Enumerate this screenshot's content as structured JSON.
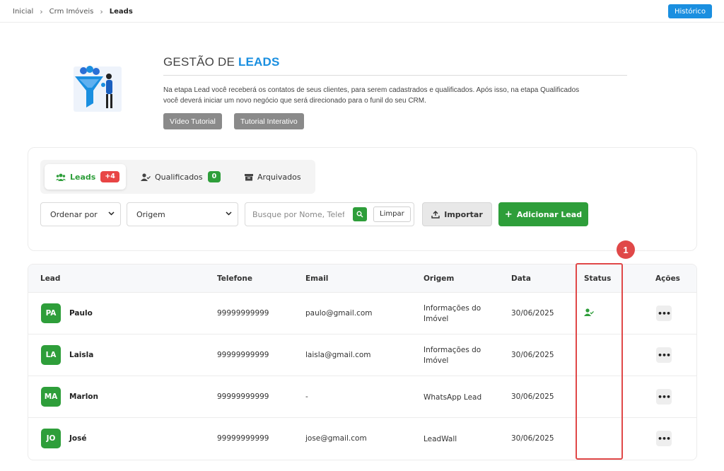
{
  "breadcrumb": [
    "Inicial",
    "Crm Imóveis",
    "Leads"
  ],
  "header": {
    "history_button": "Histórico"
  },
  "hero": {
    "title_prefix": "GESTÃO DE",
    "title_highlight": "LEADS",
    "description_line1": "Na etapa Lead você receberá os contatos de seus clientes, para serem cadastrados e qualificados. Após isso, na etapa Qualificados",
    "description_line2": "você deverá iniciar um novo negócio que será direcionado para o funil do seu CRM.",
    "buttons": [
      "Vídeo Tutorial",
      "Tutorial Interativo"
    ]
  },
  "tabs": [
    {
      "label": "Leads",
      "badge": "+4",
      "badge_color": "#e84545",
      "active": true,
      "icon": "users-icon"
    },
    {
      "label": "Qualificados",
      "badge": "0",
      "badge_color": "#2e9e3a",
      "active": false,
      "icon": "user-check-icon"
    },
    {
      "label": "Arquivados",
      "badge": null,
      "active": false,
      "icon": "archive-icon"
    }
  ],
  "filters": {
    "sort_select": "Ordenar por",
    "origin_select": "Origem",
    "search_placeholder": "Busque por Nome, Telefone",
    "clear_button": "Limpar",
    "import_button": "Importar",
    "add_button": "Adicionar Lead"
  },
  "table": {
    "columns": [
      "Lead",
      "Telefone",
      "Email",
      "Origem",
      "Data",
      "Status",
      "Ações"
    ],
    "rows": [
      {
        "initials": "PA",
        "name": "Paulo",
        "phone": "99999999999",
        "email": "paulo@gmail.com",
        "origin_line1": "Informações do",
        "origin_line2": "Imóvel",
        "date": "30/06/2025",
        "status_icon": "user-check-icon"
      },
      {
        "initials": "LA",
        "name": "Laisla",
        "phone": "99999999999",
        "email": "laisla@gmail.com",
        "origin_line1": "Informações do",
        "origin_line2": "Imóvel",
        "date": "30/06/2025",
        "status_icon": null
      },
      {
        "initials": "MA",
        "name": "Marlon",
        "phone": "99999999999",
        "email": "-",
        "origin_line1": "WhatsApp Lead",
        "origin_line2": "",
        "date": "30/06/2025",
        "status_icon": null
      },
      {
        "initials": "JO",
        "name": "José",
        "phone": "99999999999",
        "email": "jose@gmail.com",
        "origin_line1": "LeadWall",
        "origin_line2": "",
        "date": "30/06/2025",
        "status_icon": null
      }
    ],
    "actions_label": "•••"
  },
  "annotation": {
    "number": "1"
  },
  "colors": {
    "accent_blue": "#1a8fe0",
    "accent_green": "#2e9e3a",
    "badge_red": "#e84545",
    "highlight_red": "#e04848"
  }
}
